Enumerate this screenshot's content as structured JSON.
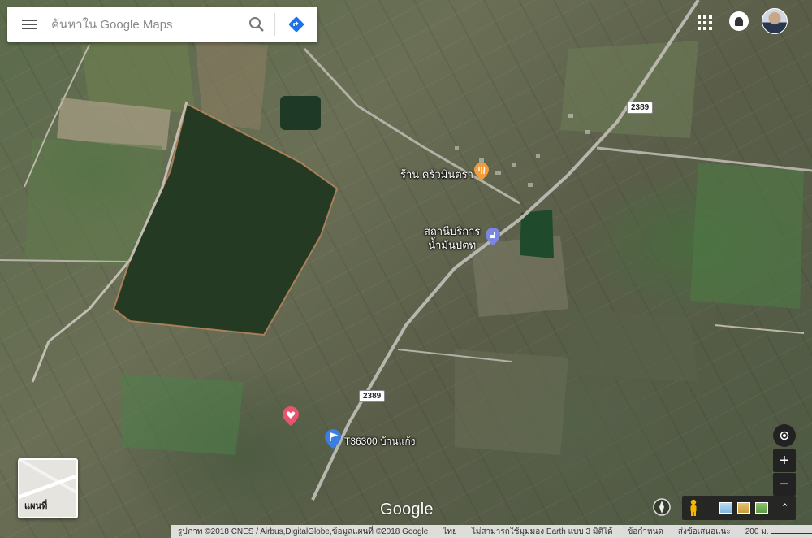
{
  "search": {
    "placeholder": "ค้นหาใน Google Maps"
  },
  "icons": {
    "menu": "menu-icon",
    "search": "search-icon",
    "directions": "directions-icon",
    "apps": "apps-grid-icon",
    "notifications": "notifications-icon",
    "pegman": "pegman-icon",
    "compass": "compass-icon"
  },
  "map": {
    "places": [
      {
        "name": "ร้าน ครัวมินตรา",
        "type": "restaurant"
      },
      {
        "name_line1": "สถานีบริการ",
        "name_line2": "น้ำมันปตท",
        "type": "gas-station"
      },
      {
        "name": "T36300 บ้านแก้ง",
        "type": "flag"
      }
    ],
    "road_shields": [
      "2389",
      "2389"
    ]
  },
  "layer_toggle": {
    "label": "แผนที่"
  },
  "controls": {
    "zoom_in": "+",
    "zoom_out": "−",
    "expand": "⌃"
  },
  "footer": {
    "logo": "Google",
    "imagery": "รูปภาพ ©2018 CNES / Airbus,DigitalGlobe,ข้อมูลแผนที่ ©2018 Google",
    "language": "ไทย",
    "earth_notice": "ไม่สามารถใช้มุมมอง Earth แบบ 3 มิติได้",
    "terms": "ข้อกำหนด",
    "feedback": "ส่งข้อเสนอแนะ",
    "scale": "200 ม."
  },
  "colors": {
    "restaurant_pin": "#f29d39",
    "gas_pin": "#7b86e0",
    "flag_pin": "#3b7ee0",
    "heart_pin": "#e8546e",
    "directions": "#1a73e8"
  }
}
